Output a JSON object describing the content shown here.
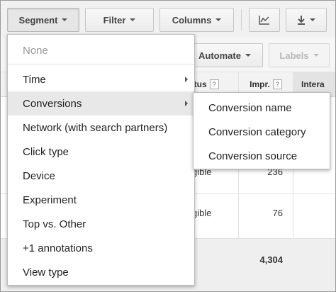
{
  "toolbar": {
    "segment_label": "Segment",
    "filter_label": "Filter",
    "columns_label": "Columns",
    "chart_icon": "line-chart-icon",
    "download_icon": "download-icon"
  },
  "row2": {
    "automate_label": "Automate",
    "labels_label": "Labels"
  },
  "table": {
    "headers": {
      "status": "atus",
      "impr": "Impr.",
      "inter": "Intera",
      "help": "?"
    },
    "rows": [
      {
        "status": "gible",
        "impr": "236"
      },
      {
        "status": "gible",
        "impr": "76"
      }
    ],
    "total_impr": "4,304"
  },
  "segment_menu": {
    "items": [
      {
        "label": "None",
        "disabled": true
      },
      {
        "label": "Time",
        "submenu": true
      },
      {
        "label": "Conversions",
        "submenu": true,
        "hover": true
      },
      {
        "label": "Network (with search partners)"
      },
      {
        "label": "Click type"
      },
      {
        "label": "Device"
      },
      {
        "label": "Experiment"
      },
      {
        "label": "Top vs. Other"
      },
      {
        "label": "+1 annotations"
      },
      {
        "label": "View type"
      }
    ]
  },
  "conversions_submenu": {
    "items": [
      {
        "label": "Conversion name"
      },
      {
        "label": "Conversion category"
      },
      {
        "label": "Conversion source"
      }
    ]
  }
}
